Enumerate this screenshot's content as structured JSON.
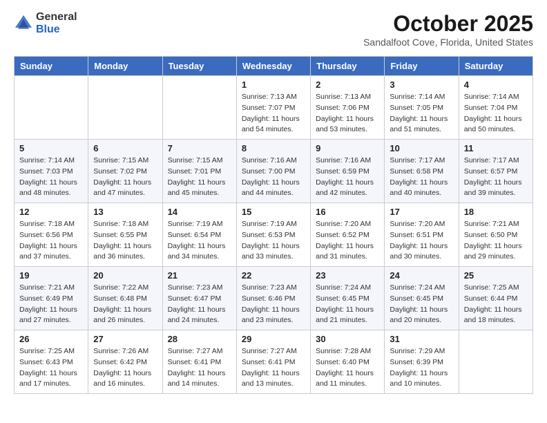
{
  "header": {
    "logo_general": "General",
    "logo_blue": "Blue",
    "month_title": "October 2025",
    "subtitle": "Sandalfoot Cove, Florida, United States"
  },
  "weekdays": [
    "Sunday",
    "Monday",
    "Tuesday",
    "Wednesday",
    "Thursday",
    "Friday",
    "Saturday"
  ],
  "weeks": [
    [
      {
        "day": "",
        "info": ""
      },
      {
        "day": "",
        "info": ""
      },
      {
        "day": "",
        "info": ""
      },
      {
        "day": "1",
        "info": "Sunrise: 7:13 AM\nSunset: 7:07 PM\nDaylight: 11 hours\nand 54 minutes."
      },
      {
        "day": "2",
        "info": "Sunrise: 7:13 AM\nSunset: 7:06 PM\nDaylight: 11 hours\nand 53 minutes."
      },
      {
        "day": "3",
        "info": "Sunrise: 7:14 AM\nSunset: 7:05 PM\nDaylight: 11 hours\nand 51 minutes."
      },
      {
        "day": "4",
        "info": "Sunrise: 7:14 AM\nSunset: 7:04 PM\nDaylight: 11 hours\nand 50 minutes."
      }
    ],
    [
      {
        "day": "5",
        "info": "Sunrise: 7:14 AM\nSunset: 7:03 PM\nDaylight: 11 hours\nand 48 minutes."
      },
      {
        "day": "6",
        "info": "Sunrise: 7:15 AM\nSunset: 7:02 PM\nDaylight: 11 hours\nand 47 minutes."
      },
      {
        "day": "7",
        "info": "Sunrise: 7:15 AM\nSunset: 7:01 PM\nDaylight: 11 hours\nand 45 minutes."
      },
      {
        "day": "8",
        "info": "Sunrise: 7:16 AM\nSunset: 7:00 PM\nDaylight: 11 hours\nand 44 minutes."
      },
      {
        "day": "9",
        "info": "Sunrise: 7:16 AM\nSunset: 6:59 PM\nDaylight: 11 hours\nand 42 minutes."
      },
      {
        "day": "10",
        "info": "Sunrise: 7:17 AM\nSunset: 6:58 PM\nDaylight: 11 hours\nand 40 minutes."
      },
      {
        "day": "11",
        "info": "Sunrise: 7:17 AM\nSunset: 6:57 PM\nDaylight: 11 hours\nand 39 minutes."
      }
    ],
    [
      {
        "day": "12",
        "info": "Sunrise: 7:18 AM\nSunset: 6:56 PM\nDaylight: 11 hours\nand 37 minutes."
      },
      {
        "day": "13",
        "info": "Sunrise: 7:18 AM\nSunset: 6:55 PM\nDaylight: 11 hours\nand 36 minutes."
      },
      {
        "day": "14",
        "info": "Sunrise: 7:19 AM\nSunset: 6:54 PM\nDaylight: 11 hours\nand 34 minutes."
      },
      {
        "day": "15",
        "info": "Sunrise: 7:19 AM\nSunset: 6:53 PM\nDaylight: 11 hours\nand 33 minutes."
      },
      {
        "day": "16",
        "info": "Sunrise: 7:20 AM\nSunset: 6:52 PM\nDaylight: 11 hours\nand 31 minutes."
      },
      {
        "day": "17",
        "info": "Sunrise: 7:20 AM\nSunset: 6:51 PM\nDaylight: 11 hours\nand 30 minutes."
      },
      {
        "day": "18",
        "info": "Sunrise: 7:21 AM\nSunset: 6:50 PM\nDaylight: 11 hours\nand 29 minutes."
      }
    ],
    [
      {
        "day": "19",
        "info": "Sunrise: 7:21 AM\nSunset: 6:49 PM\nDaylight: 11 hours\nand 27 minutes."
      },
      {
        "day": "20",
        "info": "Sunrise: 7:22 AM\nSunset: 6:48 PM\nDaylight: 11 hours\nand 26 minutes."
      },
      {
        "day": "21",
        "info": "Sunrise: 7:23 AM\nSunset: 6:47 PM\nDaylight: 11 hours\nand 24 minutes."
      },
      {
        "day": "22",
        "info": "Sunrise: 7:23 AM\nSunset: 6:46 PM\nDaylight: 11 hours\nand 23 minutes."
      },
      {
        "day": "23",
        "info": "Sunrise: 7:24 AM\nSunset: 6:45 PM\nDaylight: 11 hours\nand 21 minutes."
      },
      {
        "day": "24",
        "info": "Sunrise: 7:24 AM\nSunset: 6:45 PM\nDaylight: 11 hours\nand 20 minutes."
      },
      {
        "day": "25",
        "info": "Sunrise: 7:25 AM\nSunset: 6:44 PM\nDaylight: 11 hours\nand 18 minutes."
      }
    ],
    [
      {
        "day": "26",
        "info": "Sunrise: 7:25 AM\nSunset: 6:43 PM\nDaylight: 11 hours\nand 17 minutes."
      },
      {
        "day": "27",
        "info": "Sunrise: 7:26 AM\nSunset: 6:42 PM\nDaylight: 11 hours\nand 16 minutes."
      },
      {
        "day": "28",
        "info": "Sunrise: 7:27 AM\nSunset: 6:41 PM\nDaylight: 11 hours\nand 14 minutes."
      },
      {
        "day": "29",
        "info": "Sunrise: 7:27 AM\nSunset: 6:41 PM\nDaylight: 11 hours\nand 13 minutes."
      },
      {
        "day": "30",
        "info": "Sunrise: 7:28 AM\nSunset: 6:40 PM\nDaylight: 11 hours\nand 11 minutes."
      },
      {
        "day": "31",
        "info": "Sunrise: 7:29 AM\nSunset: 6:39 PM\nDaylight: 11 hours\nand 10 minutes."
      },
      {
        "day": "",
        "info": ""
      }
    ]
  ]
}
